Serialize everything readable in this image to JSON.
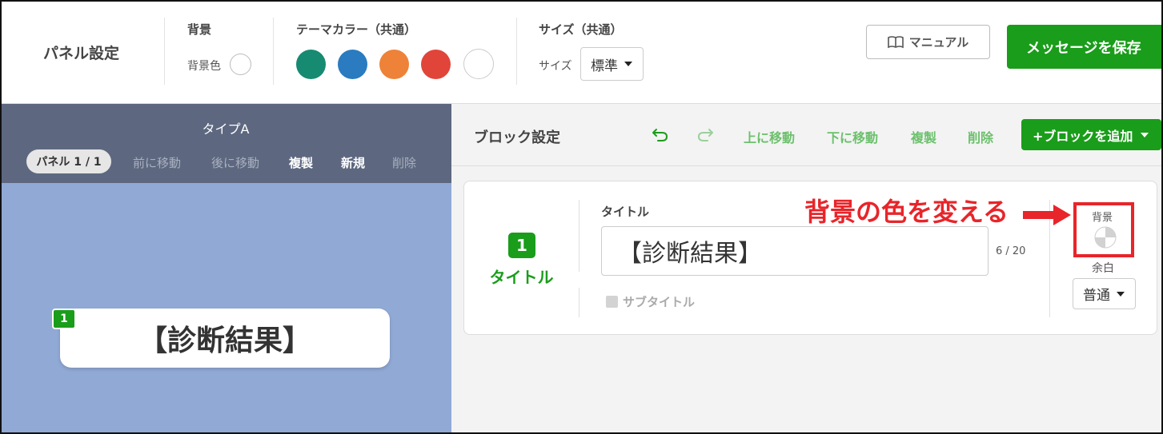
{
  "header": {
    "title": "パネル設定",
    "background_group": {
      "label": "背景",
      "color_label": "背景色"
    },
    "theme_group": {
      "label": "テーマカラー（共通）",
      "colors": [
        "#178a72",
        "#2a7bbf",
        "#ee8238",
        "#e1453a",
        "#ffffff"
      ]
    },
    "size_group": {
      "label": "サイズ（共通）",
      "size_label": "サイズ",
      "size_value": "標準"
    },
    "manual_label": "マニュアル",
    "save_label": "メッセージを保存"
  },
  "left_panel": {
    "type_title": "タイプA",
    "pill_label": "パネル 1 / 1",
    "actions": {
      "prev": "前に移動",
      "next": "後に移動",
      "duplicate": "複製",
      "new": "新規",
      "delete": "削除"
    },
    "preview": {
      "number": "1",
      "text": "【診断結果】"
    }
  },
  "block_settings": {
    "title": "ブロック設定",
    "actions": {
      "move_up": "上に移動",
      "move_down": "下に移動",
      "duplicate": "複製",
      "delete": "削除"
    },
    "add_label": "+ブロックを追加"
  },
  "block": {
    "number": "1",
    "name": "タイトル",
    "field_label": "タイトル",
    "title_value": "【診断結果】",
    "counter": "6 / 20",
    "subtitle_label": "サブタイトル",
    "bg_label": "背景",
    "padding_label": "余白",
    "padding_value": "普通"
  },
  "annotation": {
    "text": "背景の色を変える",
    "color": "#e8252a"
  },
  "colors": {
    "accent": "#1a9d1a",
    "panel_bar": "#5d6880",
    "canvas": "#90a9d5"
  }
}
